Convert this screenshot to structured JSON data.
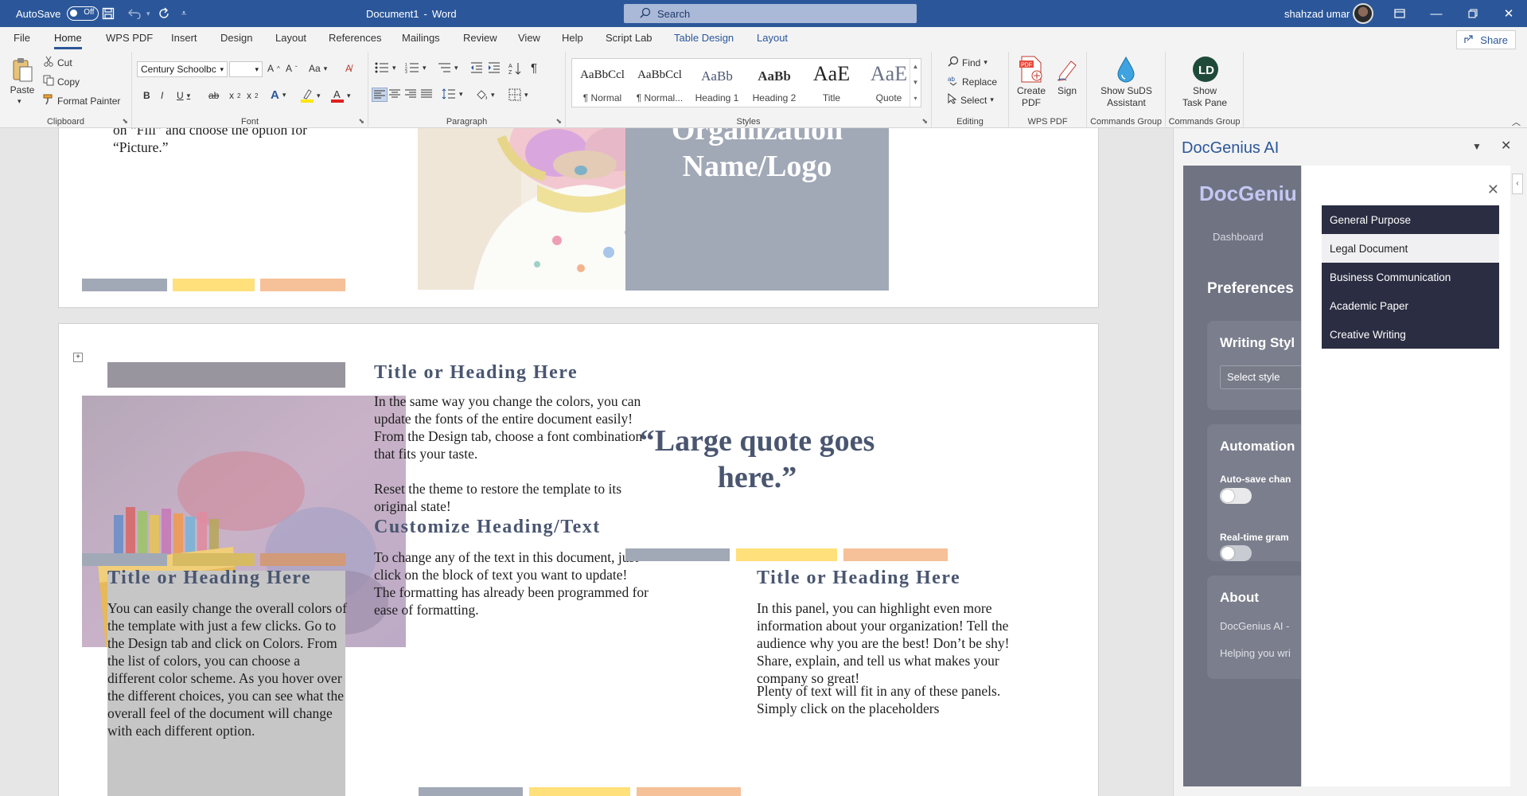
{
  "titlebar": {
    "autosave_label": "AutoSave",
    "autosave_state": "Off",
    "doc_title": "Document1",
    "app_name": "Word",
    "search_placeholder": "Search",
    "user_name": "shahzad umar",
    "accent_color": "#2b579a"
  },
  "tabs": [
    "File",
    "Home",
    "WPS PDF",
    "Insert",
    "Design",
    "Layout",
    "References",
    "Mailings",
    "Review",
    "View",
    "Help",
    "Script Lab",
    "Table Design",
    "Layout"
  ],
  "active_tab": "Home",
  "share_label": "Share",
  "ribbon": {
    "clipboard": {
      "paste": "Paste",
      "cut": "Cut",
      "copy": "Copy",
      "format_painter": "Format Painter",
      "label": "Clipboard"
    },
    "font": {
      "family": "Century Schoolbc",
      "size": "",
      "label": "Font",
      "case": "Aa"
    },
    "paragraph": {
      "label": "Paragraph"
    },
    "styles": {
      "label": "Styles",
      "items": [
        {
          "sample": "AaBbCcl",
          "name": "¶ Normal"
        },
        {
          "sample": "AaBbCcl",
          "name": "¶ Normal..."
        },
        {
          "sample": "AaBb",
          "name": "Heading 1"
        },
        {
          "sample": "AaBb",
          "name": "Heading 2"
        },
        {
          "sample": "AaE",
          "name": "Title"
        },
        {
          "sample": "AaE",
          "name": "Quote"
        }
      ]
    },
    "editing": {
      "find": "Find",
      "replace": "Replace",
      "select": "Select",
      "label": "Editing"
    },
    "wps": {
      "create_pdf_1": "Create",
      "create_pdf_2": "PDF",
      "sign": "Sign",
      "label": "WPS PDF"
    },
    "suds": {
      "line1": "Show SuDS",
      "line2": "Assistant",
      "label": "Commands Group"
    },
    "taskpane": {
      "line1": "Show",
      "line2": "Task Pane",
      "label": "Commands Group"
    }
  },
  "document": {
    "page1": {
      "fill_text": "on “Fill” and choose the option for “Picture.”",
      "org_line1": "Organization",
      "org_line2": "Name/Logo"
    },
    "page2": {
      "col2_heading": "Title or Heading Here",
      "col2_p1": "In the same way you change the colors, you can update the fonts of the entire document easily!  From the Design tab, choose a font combination that fits your taste.",
      "col2_p2": "Reset the theme to restore the template to its original state!",
      "col2_heading2": "Customize Heading/Text",
      "col2_p3": "To change any of the text in this document, just click on the block of text you want to update!  The formatting has already been programmed for ease of formatting.",
      "col1_heading": "Title or Heading Here",
      "col1_p1": "You can easily change the overall colors of the template with just a few clicks.  Go to the Design tab and click on Colors.  From the list of colors, you can choose a different color scheme.  As you hover over the different choices, you can see what the overall feel of the document will change with each different option.",
      "quote": "“Large quote goes here.”",
      "col3_heading": "Title or Heading Here",
      "col3_p1": "In this panel, you can highlight even more information about your organization!  Tell the audience why you are the best!  Don’t be shy!  Share, explain, and tell us what makes your company so great!",
      "col3_p2": "Plenty of text will fit in any of these panels.  Simply click on the placeholders"
    }
  },
  "pane": {
    "title": "DocGenius AI",
    "app": {
      "logo": "DocGeniu",
      "dashboard": "Dashboard",
      "preferences": "Preferences",
      "writing_style": "Writing Styl",
      "select_style": "Select style",
      "automation": "Automation",
      "autosave": "Auto-save chan",
      "realtime": "Real-time gram",
      "about": "About",
      "about_line1": "DocGenius AI -",
      "about_line2": "Helping you wri"
    },
    "dropdown": {
      "options": [
        "General Purpose",
        "Legal Document",
        "Business Communication",
        "Academic Paper",
        "Creative Writing"
      ],
      "hovered_index": 1
    }
  }
}
